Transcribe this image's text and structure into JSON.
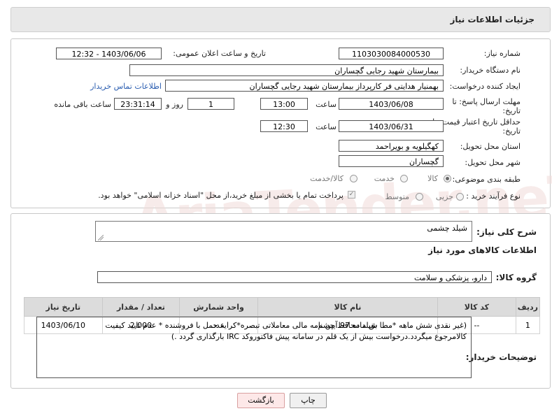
{
  "header": {
    "title": "جزئیات اطلاعات نیاز"
  },
  "form": {
    "need_number_label": "شماره نیاز:",
    "need_number": "1103030084000530",
    "announce_label": "تاریخ و ساعت اعلان عمومی:",
    "announce_value": "1403/06/06 - 12:32",
    "buyer_label": "نام دستگاه خریدار:",
    "buyer_value": "بیمارستان شهید رجایی گچساران",
    "creator_label": "ایجاد کننده درخواست:",
    "creator_value": "بهمنیار هدایتی فر کارپرداز بیمارستان شهید رجایی گچساران",
    "contact_link": "اطلاعات تماس خریدار",
    "deadline_label_1": "مهلت ارسال پاسخ: تا",
    "deadline_label_2": "تاریخ:",
    "deadline_date": "1403/06/08",
    "time_label": "ساعت",
    "deadline_time": "13:00",
    "days_value": "1",
    "days_label": "روز و",
    "remaining_time": "23:31:14",
    "remaining_label": "ساعت باقی مانده",
    "price_label_1": "حداقل تاریخ اعتبار قیمت: تا",
    "price_label_2": "تاریخ:",
    "price_date": "1403/06/31",
    "price_time_label": "ساعت",
    "price_time": "12:30",
    "province_label": "استان محل تحویل:",
    "province_value": "کهگیلویه و بویراحمد",
    "city_label": "شهر محل تحویل:",
    "city_value": "گچساران",
    "category_label": "طبقه بندی موضوعی:",
    "cat_goods": "کالا",
    "cat_service": "خدمت",
    "cat_goods_service": "کالا/خدمت",
    "process_label": "نوع فرآیند خرید :",
    "proc_partial": "جزیی",
    "proc_medium": "متوسط",
    "payment_note": "پرداخت تمام یا بخشی از مبلغ خرید،از محل \"اسناد خزانه اسلامی\" خواهد بود."
  },
  "details": {
    "description_label": "شرح کلی نیاز:",
    "description_value": "شیلد چشمی",
    "items_title": "اطلاعات کالاهای مورد نیاز",
    "group_label": "گروه کالا:",
    "group_value": "دارو، پزشکی و سلامت",
    "table": {
      "headers": [
        "ردیف",
        "کد کالا",
        "نام کالا",
        "واحد شمارش",
        "تعداد / مقدار",
        "تاریخ نیاز"
      ],
      "rows": [
        [
          "1",
          "--",
          "شیلد محافظ چشم",
          "عدد",
          "2,000",
          "1403/06/10"
        ]
      ]
    },
    "buyer_notes_label": "توضیحات خریدار:",
    "buyer_notes_line1": "(غیر نقدی شش ماهه  *مطا بق ماده 97 آیین نامه مالی معاملاتی تبصره*کرایه حمل با فروشنده * عدم تایید کیفیت",
    "buyer_notes_line2": "کالامرجوع میگردد.درخواست بیش از یک قلم در سامانه  پیش فاکتوروکد IRC بارگذاری گردد .)"
  },
  "buttons": {
    "print": "چاپ",
    "back": "بازگشت"
  },
  "watermark": "AriaTender.neT",
  "colors": {
    "link": "#2a5db0",
    "header_bg": "#e8e8e8",
    "back_button_bg": "#fde8e8"
  }
}
